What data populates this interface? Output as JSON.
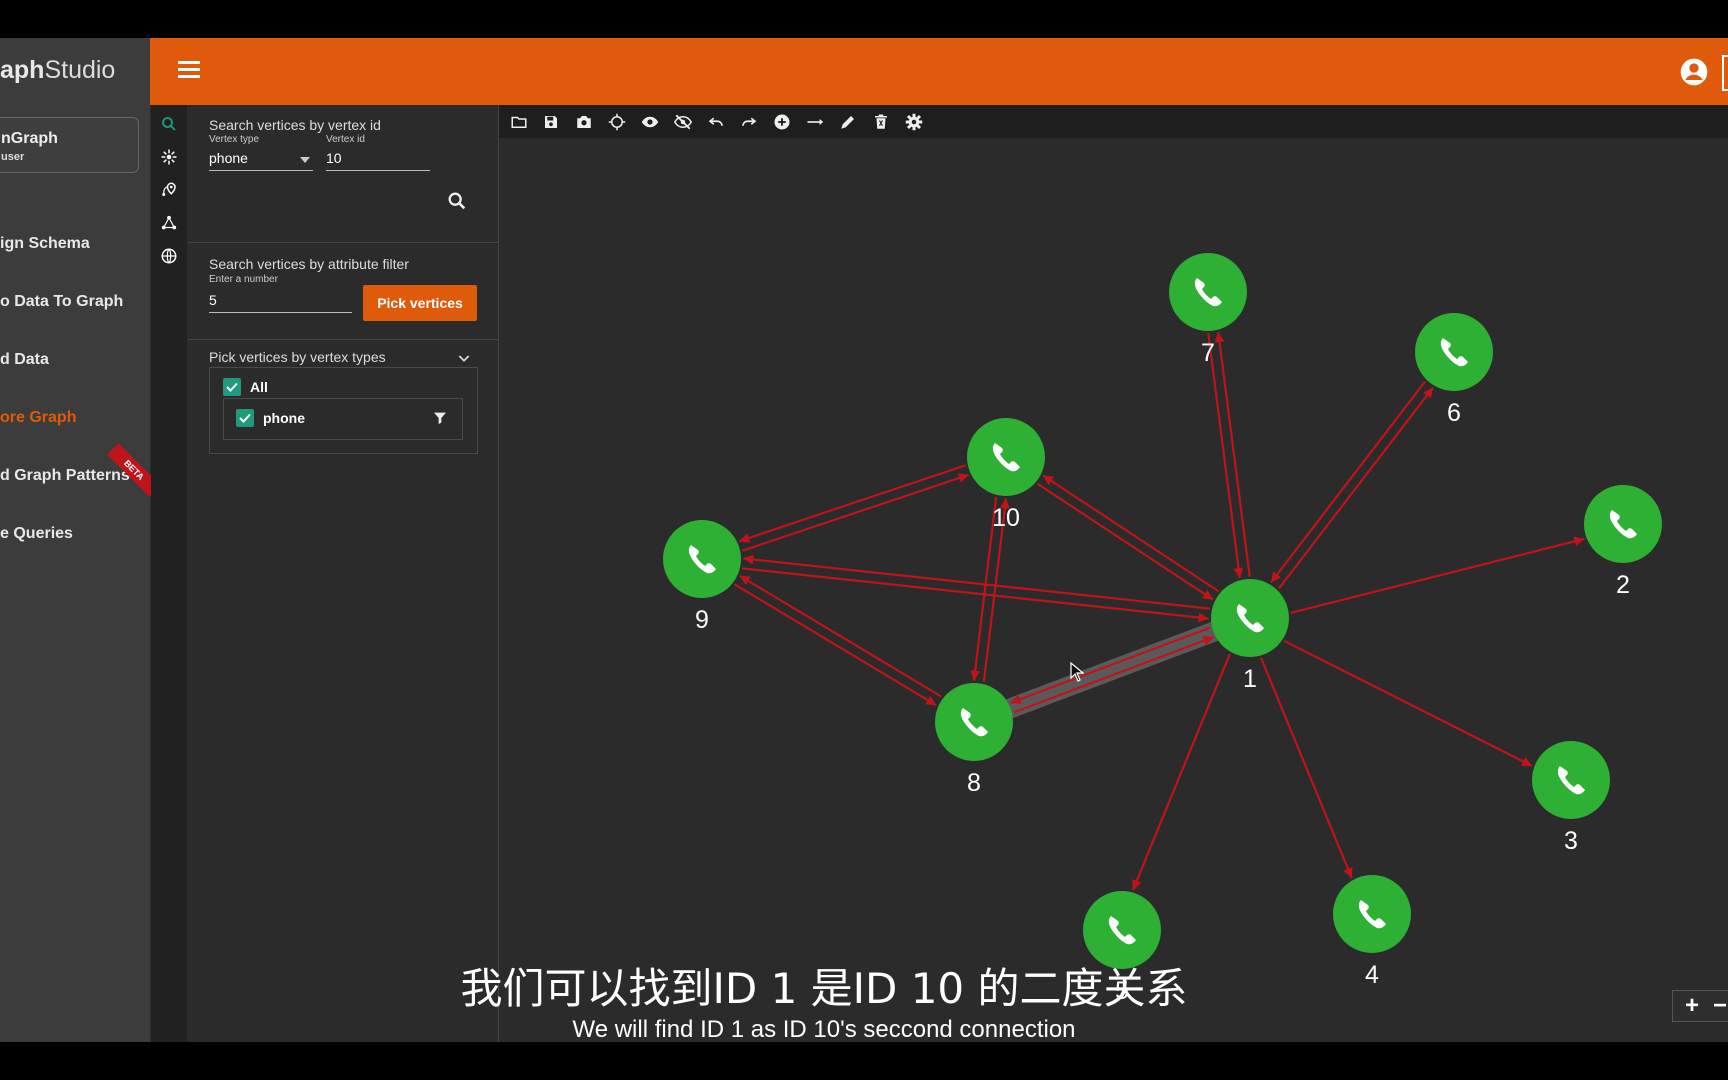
{
  "app": {
    "logo_bold": "aph",
    "logo_rest": "Studio"
  },
  "graph_card": {
    "name": "nGraph",
    "user": "user"
  },
  "nav": [
    {
      "label": "ign Schema",
      "active": false
    },
    {
      "label": "o Data To Graph",
      "active": false
    },
    {
      "label": "d Data",
      "active": false
    },
    {
      "label": "ore Graph",
      "active": true
    },
    {
      "label": "d Graph Patterns",
      "active": false
    },
    {
      "label": "e Queries",
      "active": false
    }
  ],
  "beta_badge": "BETA",
  "search_by_id": {
    "title": "Search vertices by vertex id",
    "vertex_type_label": "Vertex type",
    "vertex_type_value": "phone",
    "vertex_id_label": "Vertex id",
    "vertex_id_value": "10"
  },
  "attribute_filter": {
    "title": "Search vertices by attribute filter",
    "hint": "Enter a number",
    "value": "5",
    "button": "Pick vertices"
  },
  "vertex_types": {
    "title": "Pick vertices by vertex types",
    "all_label": "All",
    "type_label": "phone"
  },
  "toolbar_icons": [
    "folder-icon",
    "save-icon",
    "camera-icon",
    "locate-icon",
    "eye-icon",
    "eye-off-icon",
    "undo-icon",
    "redo-icon",
    "add-vertex-icon",
    "add-edge-icon",
    "edit-icon",
    "delete-icon",
    "settings-icon"
  ],
  "colors": {
    "accent": "#e05a0c",
    "vertex": "#2db034",
    "edge": "#c0141b",
    "highlight": "#5a5a5a"
  },
  "graph": {
    "vertices": [
      {
        "id": "1"
      },
      {
        "id": "2"
      },
      {
        "id": "3"
      },
      {
        "id": "4"
      },
      {
        "id": "5"
      },
      {
        "id": "6"
      },
      {
        "id": "7"
      },
      {
        "id": "8"
      },
      {
        "id": "9"
      },
      {
        "id": "10"
      }
    ],
    "edges": [
      [
        "1",
        "2"
      ],
      [
        "1",
        "3"
      ],
      [
        "1",
        "4"
      ],
      [
        "1",
        "5"
      ],
      [
        "1",
        "6"
      ],
      [
        "6",
        "1"
      ],
      [
        "7",
        "1"
      ],
      [
        "1",
        "7"
      ],
      [
        "1",
        "8"
      ],
      [
        "8",
        "1"
      ],
      [
        "1",
        "9"
      ],
      [
        "9",
        "1"
      ],
      [
        "1",
        "10"
      ],
      [
        "10",
        "1"
      ],
      [
        "9",
        "10"
      ],
      [
        "10",
        "9"
      ],
      [
        "9",
        "8"
      ],
      [
        "8",
        "9"
      ],
      [
        "8",
        "10"
      ],
      [
        "10",
        "8"
      ]
    ],
    "highlighted_edge": [
      "8",
      "1"
    ]
  },
  "zoom": {
    "plus": "+",
    "minus": "−"
  },
  "subtitle": {
    "chinese": "我们可以找到ID 1 是ID 10 的二度关系",
    "english": "We will find ID 1 as ID 10's seccond connection"
  }
}
